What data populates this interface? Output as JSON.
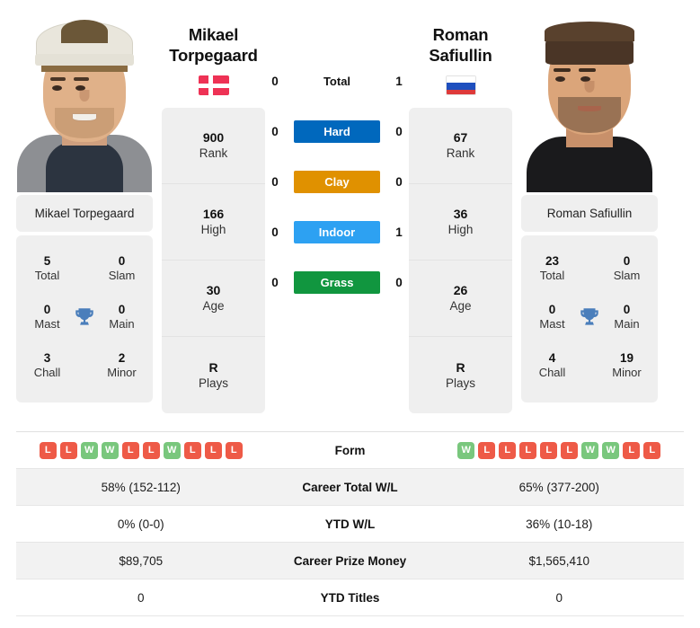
{
  "players": {
    "left": {
      "first_name": "Mikael",
      "last_name": "Torpegaard",
      "full_name": "Mikael Torpegaard",
      "flag": "denmark-flag-icon",
      "rank": "900",
      "rank_label": "Rank",
      "high": "166",
      "high_label": "High",
      "age": "30",
      "age_label": "Age",
      "plays": "R",
      "plays_label": "Plays",
      "titles": {
        "total": "5",
        "total_label": "Total",
        "slam": "0",
        "slam_label": "Slam",
        "mast": "0",
        "mast_label": "Mast",
        "main": "0",
        "main_label": "Main",
        "chall": "3",
        "chall_label": "Chall",
        "minor": "2",
        "minor_label": "Minor"
      }
    },
    "right": {
      "first_name": "Roman",
      "last_name": "Safiullin",
      "full_name": "Roman Safiullin",
      "flag": "russia-flag-icon",
      "rank": "67",
      "rank_label": "Rank",
      "high": "36",
      "high_label": "High",
      "age": "26",
      "age_label": "Age",
      "plays": "R",
      "plays_label": "Plays",
      "titles": {
        "total": "23",
        "total_label": "Total",
        "slam": "0",
        "slam_label": "Slam",
        "mast": "0",
        "mast_label": "Mast",
        "main": "0",
        "main_label": "Main",
        "chall": "4",
        "chall_label": "Chall",
        "minor": "19",
        "minor_label": "Minor"
      }
    }
  },
  "h2h": {
    "rows": [
      {
        "label": "Total",
        "left": "0",
        "right": "1",
        "color": "",
        "plain": true
      },
      {
        "label": "Hard",
        "left": "0",
        "right": "0",
        "color": "#0068bd",
        "plain": false
      },
      {
        "label": "Clay",
        "left": "0",
        "right": "0",
        "color": "#e09100",
        "plain": false
      },
      {
        "label": "Indoor",
        "left": "0",
        "right": "1",
        "color": "#2da1f2",
        "plain": false
      },
      {
        "label": "Grass",
        "left": "0",
        "right": "0",
        "color": "#11963f",
        "plain": false
      }
    ]
  },
  "table": {
    "form_label": "Form",
    "form_left": [
      "L",
      "L",
      "W",
      "W",
      "L",
      "L",
      "W",
      "L",
      "L",
      "L"
    ],
    "form_right": [
      "W",
      "L",
      "L",
      "L",
      "L",
      "L",
      "W",
      "W",
      "L",
      "L"
    ],
    "rows": [
      {
        "label": "Career Total W/L",
        "left": "58% (152-112)",
        "right": "65% (377-200)"
      },
      {
        "label": "YTD W/L",
        "left": "0% (0-0)",
        "right": "36% (10-18)"
      },
      {
        "label": "Career Prize Money",
        "left": "$89,705",
        "right": "$1,565,410"
      },
      {
        "label": "YTD Titles",
        "left": "0",
        "right": "0"
      }
    ]
  },
  "colors": {
    "hard": "#0068bd",
    "clay": "#e09100",
    "indoor": "#2da1f2",
    "grass": "#11963f",
    "win": "#79c77d",
    "loss": "#ee5a47",
    "trophy": "#4a7ebb",
    "card_bg": "#efefef"
  }
}
